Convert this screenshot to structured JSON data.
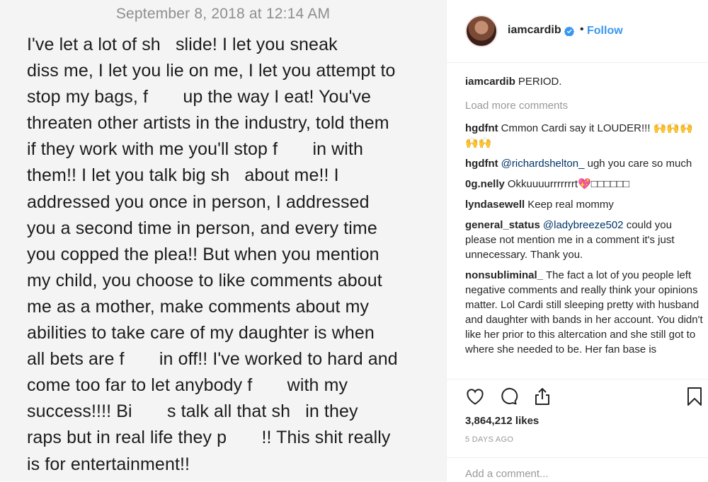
{
  "post": {
    "date": "September 8, 2018 at 12:14 AM",
    "lines": [
      "I've let a lot of sh   slide! I let you sneak",
      "diss me, I let you lie on me, I let you attempt to",
      "stop my bags, f       up the way I eat! You've",
      "threaten other artists in the industry, told them",
      "if they work with me you'll stop f       in with",
      "them!! I let you talk big sh   about me!! I",
      "addressed you once in person, I addressed",
      "you a second time in person, and every time",
      "you copped the plea!! But when you mention",
      "my child, you choose to like comments about",
      "me as a mother, make comments about my",
      "abilities to take care of my daughter is when",
      "all bets are f       in off!! I've worked to hard and",
      "come too far to let anybody f       with my",
      "success!!!! Bi       s talk all that sh   in they",
      "raps but in real life they p       !! This shit really",
      "is for entertainment!!"
    ]
  },
  "header": {
    "username": "iamcardib",
    "separator": "•",
    "follow_label": "Follow"
  },
  "caption": {
    "username": "iamcardib",
    "text": "PERIOD."
  },
  "load_more_label": "Load more comments",
  "comments": [
    {
      "username": "hgdfnt",
      "mention": "",
      "text": "Cmmon Cardi say it LOUDER!!! 🙌🙌🙌🙌🙌"
    },
    {
      "username": "hgdfnt",
      "mention": "@richardshelton_",
      "text": "ugh you care so much"
    },
    {
      "username": "0g.nelly",
      "mention": "",
      "text": "Okkuuuurrrrrrrt💖□□□□□□"
    },
    {
      "username": "lyndasewell",
      "mention": "",
      "text": "Keep real mommy"
    },
    {
      "username": "general_status",
      "mention": "@ladybreeze502",
      "text": "could you please not mention me in a comment it's just unnecessary. Thank you."
    },
    {
      "username": "nonsubliminal_",
      "mention": "",
      "text": "The fact a lot of you people left negative comments and really think your opinions matter. Lol Cardi still sleeping pretty with husband and daughter with bands in her account. You didn't like her prior to this altercation and she still got to where she needed to be. Her fan base is"
    }
  ],
  "likes": "3,864,212 likes",
  "time_ago": "5 DAYS AGO",
  "add_comment_placeholder": "Add a comment...",
  "icons": {
    "like": "heart-icon",
    "comment": "comment-bubble-icon",
    "share": "share-icon",
    "save": "bookmark-icon",
    "verified": "verified-badge-icon"
  },
  "colors": {
    "link": "#3897f0",
    "mention": "#003569",
    "muted": "#999999",
    "text": "#262626"
  }
}
